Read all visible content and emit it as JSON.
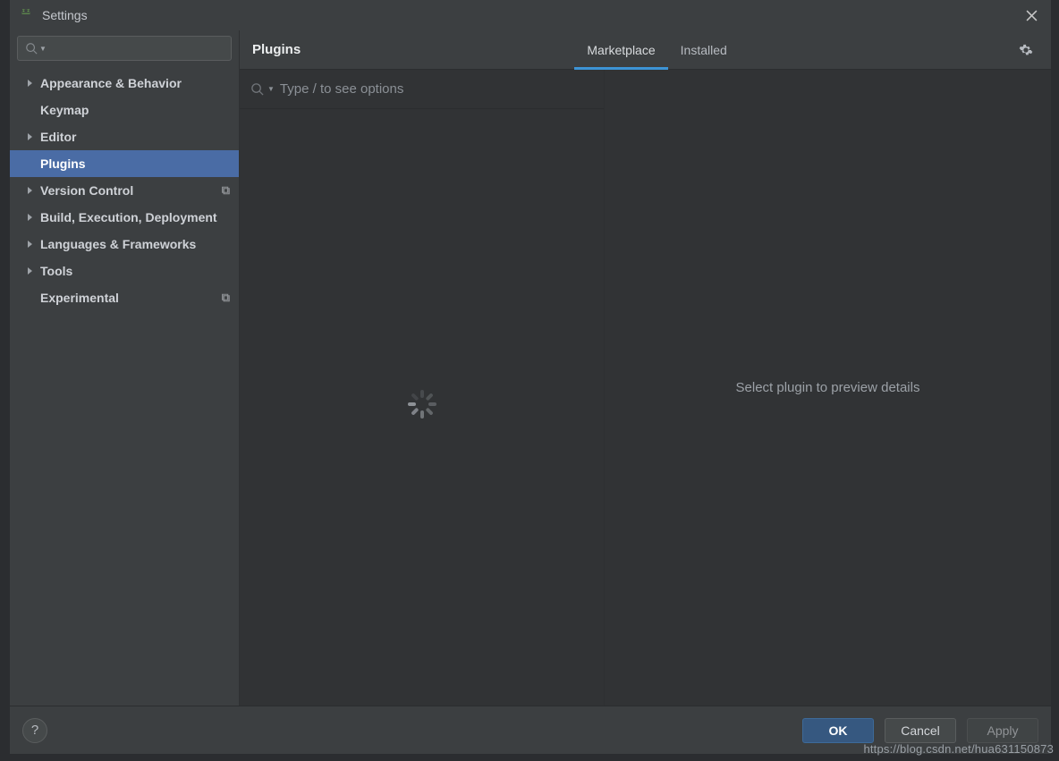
{
  "titlebar": {
    "title": "Settings"
  },
  "sidebar": {
    "search_placeholder": "",
    "items": [
      {
        "label": "Appearance & Behavior",
        "expandable": true
      },
      {
        "label": "Keymap",
        "expandable": false
      },
      {
        "label": "Editor",
        "expandable": true
      },
      {
        "label": "Plugins",
        "expandable": false,
        "selected": true
      },
      {
        "label": "Version Control",
        "expandable": true,
        "badge": "profile"
      },
      {
        "label": "Build, Execution, Deployment",
        "expandable": true
      },
      {
        "label": "Languages & Frameworks",
        "expandable": true
      },
      {
        "label": "Tools",
        "expandable": true
      },
      {
        "label": "Experimental",
        "expandable": false,
        "badge": "profile"
      }
    ]
  },
  "main": {
    "heading": "Plugins",
    "tabs": [
      {
        "label": "Marketplace",
        "active": true
      },
      {
        "label": "Installed",
        "active": false
      }
    ],
    "search_placeholder": "Type / to see options",
    "detail_placeholder": "Select plugin to preview details"
  },
  "footer": {
    "ok": "OK",
    "cancel": "Cancel",
    "apply": "Apply"
  },
  "watermark": "https://blog.csdn.net/hua631150873"
}
